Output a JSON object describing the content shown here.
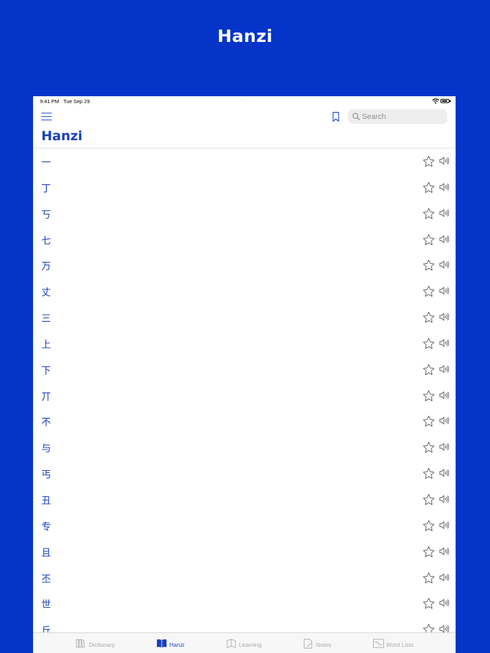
{
  "banner": {
    "title": "Hanzi"
  },
  "status_bar": {
    "time": "9:41 PM",
    "date": "Tue Sep 29",
    "dots": "···"
  },
  "header": {
    "title": "Hanzi"
  },
  "search": {
    "placeholder": "Search",
    "value": ""
  },
  "list": {
    "items": [
      {
        "hanzi": "一"
      },
      {
        "hanzi": "丁"
      },
      {
        "hanzi": "丂"
      },
      {
        "hanzi": "七"
      },
      {
        "hanzi": "万"
      },
      {
        "hanzi": "丈"
      },
      {
        "hanzi": "三"
      },
      {
        "hanzi": "上"
      },
      {
        "hanzi": "下"
      },
      {
        "hanzi": "丌"
      },
      {
        "hanzi": "不"
      },
      {
        "hanzi": "与"
      },
      {
        "hanzi": "丐"
      },
      {
        "hanzi": "丑"
      },
      {
        "hanzi": "专"
      },
      {
        "hanzi": "且"
      },
      {
        "hanzi": "丕"
      },
      {
        "hanzi": "世"
      },
      {
        "hanzi": "丘"
      }
    ]
  },
  "tabs": [
    {
      "label": "Dictionary",
      "icon": "dictionary-icon",
      "active": false
    },
    {
      "label": "Hanzi",
      "icon": "book-icon",
      "active": true
    },
    {
      "label": "Learning",
      "icon": "learning-icon",
      "active": false
    },
    {
      "label": "Notes",
      "icon": "notes-icon",
      "active": false
    },
    {
      "label": "Word Lists",
      "icon": "word-lists-icon",
      "active": false
    }
  ],
  "colors": {
    "background": "#0434c8",
    "accent": "#1a3fbf",
    "tab_inactive": "#a9a9a9"
  }
}
